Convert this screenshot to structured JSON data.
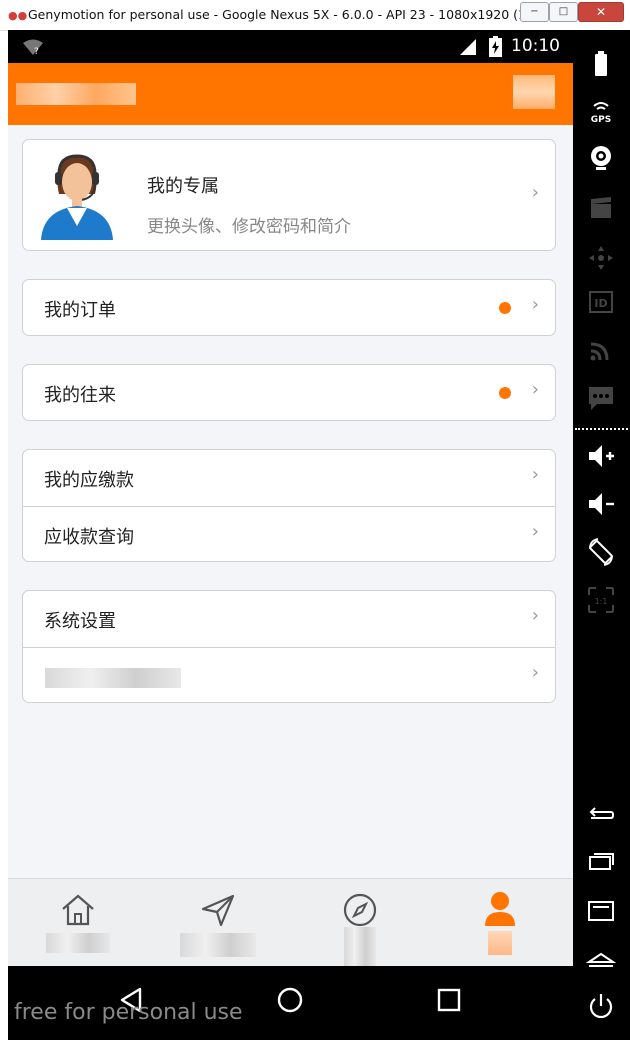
{
  "window": {
    "title": "Genymotion for personal use - Google Nexus 5X - 6.0.0 - API 23 - 1080x1920 (1080...",
    "minimize_label": "−",
    "maximize_label": "□",
    "close_label": "✕"
  },
  "statusbar": {
    "time": "10:10"
  },
  "profile": {
    "title": "我的专属",
    "subtitle": "更换头像、修改密码和简介"
  },
  "menu": {
    "orders": "我的订单",
    "dealings": "我的往来",
    "payables": "我的应缴款",
    "receivables": "应收款查询",
    "settings": "系统设置"
  },
  "chevron": "›",
  "watermark": "free for personal use",
  "colors": {
    "accent": "#ff7500",
    "background": "#f4f5f8",
    "tab_inactive": "#555555"
  }
}
